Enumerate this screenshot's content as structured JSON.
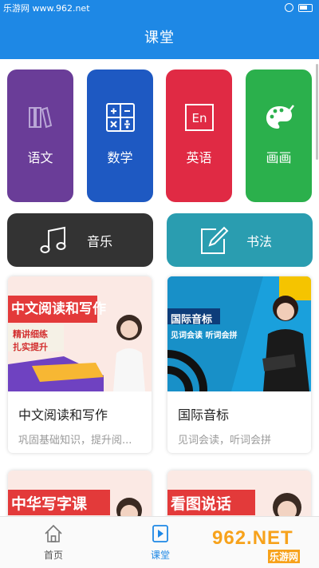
{
  "status_bar": {
    "site": "乐游网 www.962.net"
  },
  "header": {
    "title": "课堂"
  },
  "subjects": [
    {
      "label": "语文",
      "icon": "books-icon",
      "color": "#6a3d98"
    },
    {
      "label": "数学",
      "icon": "math-operators-icon",
      "color": "#1e59c2"
    },
    {
      "label": "英语",
      "icon": "en-letters-icon",
      "color": "#e02a44"
    },
    {
      "label": "画画",
      "icon": "palette-icon",
      "color": "#2bb04c"
    }
  ],
  "wide_subjects": [
    {
      "label": "音乐",
      "icon": "music-note-icon",
      "color": "#333333"
    },
    {
      "label": "书法",
      "icon": "pen-edit-icon",
      "color": "#2a9db0"
    }
  ],
  "courses": [
    {
      "title": "中文阅读和写作",
      "desc": "巩固基础知识，提升阅...",
      "thumb_text": "中文阅读和写作",
      "thumb_sub1": "精讲细练",
      "thumb_sub2": "扎实提升"
    },
    {
      "title": "国际音标",
      "desc": "见词会读，听词会拼",
      "thumb_text": "国际音标",
      "thumb_sub1": "见词会读 听词会拼"
    },
    {
      "thumb_text": "中华写字课"
    },
    {
      "thumb_text": "看图说话"
    }
  ],
  "bottom_nav": [
    {
      "label": "首页",
      "icon": "home-icon"
    },
    {
      "label": "课堂",
      "icon": "play-video-icon"
    }
  ],
  "watermark": {
    "num": "962.NET",
    "sub": "乐游网"
  },
  "colors": {
    "primary": "#1e88e5"
  }
}
